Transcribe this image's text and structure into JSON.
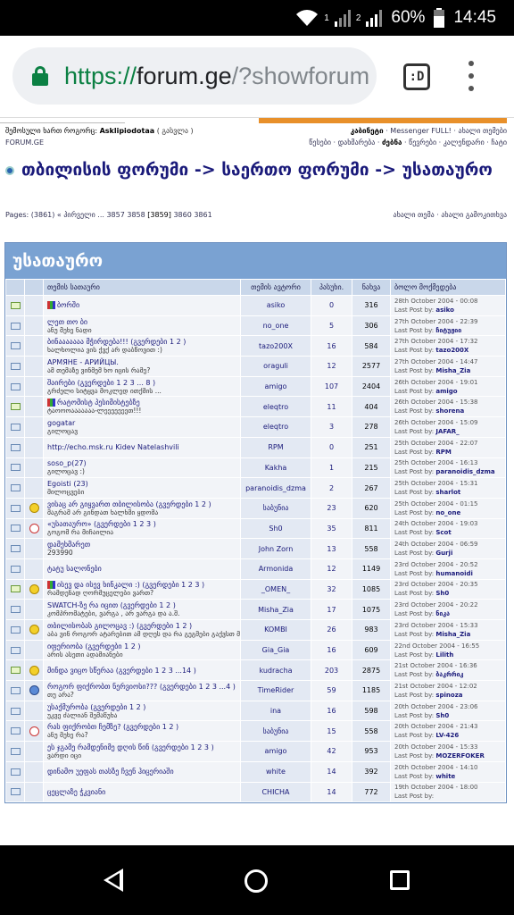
{
  "status": {
    "battery": "60%",
    "time": "14:45",
    "sim1": "1",
    "sim2": "2"
  },
  "browser": {
    "scheme": "https://",
    "host": "forum.ge",
    "path": "/?showforum",
    "tab_count": ":D"
  },
  "header": {
    "user_prefix": "შემოსული ხართ როგორც:",
    "user_name": "Asklipiodotaa",
    "user_logout": "( გასვლა )",
    "site": "FORUM.GE",
    "links_line1": [
      "კაბინეტი",
      "Messenger FULL!",
      "ახალი თემები"
    ],
    "links_line2": [
      "წესები",
      "დახმარება",
      "ძებნა",
      "წევრები",
      "კალენდარი",
      "ჩატი"
    ]
  },
  "breadcrumb": "თბილისის ფორუმი -> საერთო ფორუმი -> უსათაურო",
  "pagination": {
    "label": "Pages: (3861)",
    "first": "« პირველი ...",
    "before": "3857 3858",
    "current": "[3859]",
    "after": "3860 3861",
    "actions": "ახალი თემა · ახალი გამოკითხვა"
  },
  "forum": {
    "title": "უსათაურო",
    "columns": [
      "",
      "",
      "თემის სათაური",
      "თემის ავტორი",
      "პასუხი.",
      "ნახვა",
      "ბოლო მოქმედება"
    ],
    "rows": [
      {
        "icon": "env-hot",
        "mood": "",
        "bars": true,
        "title": "ბორში",
        "desc": "",
        "author": "asiko",
        "replies": "0",
        "views": "316",
        "date": "28th October 2004 - 00:08",
        "last_label": "Last Post by:",
        "last_by": "asiko"
      },
      {
        "icon": "env",
        "mood": "",
        "bars": false,
        "title": "ლეთ თო ბი",
        "desc": "ანუ მეხე ნადი",
        "author": "no_one",
        "replies": "5",
        "views": "306",
        "date": "27th October 2004 - 22:39",
        "last_label": "Last Post by:",
        "last_by": "ჩიტუჟიი"
      },
      {
        "icon": "env",
        "mood": "",
        "bars": false,
        "title": "ბინააააააა მჭირდება!!! (გვერდები 1 2 )",
        "desc": "ხალხოლია ვის ქვქ არ დაბწოვით :)",
        "author": "tazo200X",
        "replies": "16",
        "views": "584",
        "date": "27th October 2004 - 17:32",
        "last_label": "Last Post by:",
        "last_by": "tazo200X"
      },
      {
        "icon": "env",
        "mood": "",
        "bars": false,
        "title": "АРМЯНЕ - АРИЙЦЫ.",
        "desc": "ამ თემაზე ვინმემ ხო იცის რამე?",
        "author": "oraguli",
        "replies": "12",
        "views": "2577",
        "date": "27th October 2004 - 14:47",
        "last_label": "Last Post by:",
        "last_by": "Misha_Zia"
      },
      {
        "icon": "env",
        "mood": "",
        "bars": false,
        "title": "შაირები (გვერდები 1 2 3 ... 8 )",
        "desc": "გრძელი სიტყვა მოკლედ ითქმის ...",
        "author": "amigo",
        "replies": "107",
        "views": "2404",
        "date": "26th October 2004 - 19:01",
        "last_label": "Last Post by:",
        "last_by": "amigo"
      },
      {
        "icon": "env-hot",
        "mood": "",
        "bars": true,
        "title": "რატომისტ პესიმისტებზე",
        "desc": "ტაოოოააააააა-ლეეეეეეეთ!!!",
        "author": "eleqtro",
        "replies": "11",
        "views": "404",
        "date": "26th October 2004 - 15:38",
        "last_label": "Last Post by:",
        "last_by": "shorena"
      },
      {
        "icon": "env",
        "mood": "",
        "bars": false,
        "title": "gogatar",
        "desc": "გილოცავ",
        "author": "eleqtro",
        "replies": "3",
        "views": "278",
        "date": "26th October 2004 - 15:09",
        "last_label": "Last Post by:",
        "last_by": "JAFAR_"
      },
      {
        "icon": "env",
        "mood": "",
        "bars": false,
        "title": "http://echo.msk.ru Kidev Natelashvili",
        "desc": "",
        "author": "RPM",
        "replies": "0",
        "views": "251",
        "date": "25th October 2004 - 22:07",
        "last_label": "Last Post by:",
        "last_by": "RPM"
      },
      {
        "icon": "env",
        "mood": "",
        "bars": false,
        "title": "soso_p(27)",
        "desc": "გილოცავ :)",
        "author": "Kakha",
        "replies": "1",
        "views": "215",
        "date": "25th October 2004 - 16:13",
        "last_label": "Last Post by:",
        "last_by": "paranoidis_dzma"
      },
      {
        "icon": "env",
        "mood": "",
        "bars": false,
        "title": "Egoisti (23)",
        "desc": "მილოცვები",
        "author": "paranoidis_dzma",
        "replies": "2",
        "views": "267",
        "date": "25th October 2004 - 15:31",
        "last_label": "Last Post by:",
        "last_by": "sharlot"
      },
      {
        "icon": "env",
        "mood": "smile",
        "bars": false,
        "title": "ვისაც არ გიყვართ თბილისობა (გვერდები 1 2 )",
        "desc": "მაგრამ არ გინდათ ხალხში ყდომა",
        "author": "საბუნია",
        "replies": "23",
        "views": "620",
        "date": "25th October 2004 - 01:15",
        "last_label": "Last Post by:",
        "last_by": "no_one"
      },
      {
        "icon": "env",
        "mood": "jp",
        "bars": false,
        "title": "«უსათაურო» (გვერდები 1 2 3 )",
        "desc": "გოგომ რა მიჩაილია",
        "author": "Sh0",
        "replies": "35",
        "views": "811",
        "date": "24th October 2004 - 19:03",
        "last_label": "Last Post by:",
        "last_by": "Scot"
      },
      {
        "icon": "env",
        "mood": "",
        "bars": false,
        "title": "დამეხმარეთ",
        "desc": "293990",
        "author": "John Zorn",
        "replies": "13",
        "views": "558",
        "date": "24th October 2004 - 06:59",
        "last_label": "Last Post by:",
        "last_by": "Gurji"
      },
      {
        "icon": "env",
        "mood": "",
        "bars": false,
        "title": "ტატუ სალონები",
        "desc": "",
        "author": "Armonida",
        "replies": "12",
        "views": "1149",
        "date": "23rd October 2004 - 20:52",
        "last_label": "Last Post by:",
        "last_by": "humanoidi"
      },
      {
        "icon": "env-hot",
        "mood": "smile",
        "bars": true,
        "title": "ისევ და ისევ ხინკალი :) (გვერდები 1 2 3 )",
        "desc": "რამდენად ღორმუცელები ვართ?",
        "author": "_OMEN_",
        "replies": "32",
        "views": "1085",
        "date": "23rd October 2004 - 20:35",
        "last_label": "Last Post by:",
        "last_by": "Sh0"
      },
      {
        "icon": "env",
        "mood": "",
        "bars": false,
        "title": "SWATCH-ზე რა იცით (გვერდები 1 2 )",
        "desc": "კომპრომატები, ვარგა , არ ვარგა და ა.შ.",
        "author": "Misha_Zia",
        "replies": "17",
        "views": "1075",
        "date": "23rd October 2004 - 20:22",
        "last_label": "Last Post by:",
        "last_by": "ნიკა"
      },
      {
        "icon": "env",
        "mood": "smile",
        "bars": false,
        "title": "თბილისობას გილოცავ :) (გვერდები 1 2 )",
        "desc": "აბა ვინ როგორ ატარებით ამ დღეს და რა გეგმები გაქვსთ მომავალში",
        "author": "KOMBI",
        "replies": "26",
        "views": "983",
        "date": "23rd October 2004 - 15:33",
        "last_label": "Last Post by:",
        "last_by": "Misha_Zia"
      },
      {
        "icon": "env",
        "mood": "",
        "bars": false,
        "title": "იფერიობა (გვერდები 1 2 )",
        "desc": "არის ასეთი ადამიანები",
        "author": "Gia_Gia",
        "replies": "16",
        "views": "609",
        "date": "22nd October 2004 - 16:55",
        "last_label": "Last Post by:",
        "last_by": "Lilith"
      },
      {
        "icon": "env-hot",
        "mood": "cool",
        "bars": false,
        "title": "მინდა ვიცო სწერაა (გვერდები 1 2 3 ...14 )",
        "desc": "",
        "author": "kudracha",
        "replies": "203",
        "views": "2875",
        "date": "21st October 2004 - 16:36",
        "last_label": "Last Post by:",
        "last_by": "ბაკრრიკ"
      },
      {
        "icon": "env",
        "mood": "q",
        "bars": false,
        "title": "როგორ ფიქრობთ ნერვიოსი??? (გვერდები 1 2 3 ...4 )",
        "desc": "თუ არა?",
        "author": "TimeRider",
        "replies": "59",
        "views": "1185",
        "date": "21st October 2004 - 12:02",
        "last_label": "Last Post by:",
        "last_by": "spinoza"
      },
      {
        "icon": "env",
        "mood": "",
        "bars": false,
        "title": "უსაქმურობა (გვერდები 1 2 )",
        "desc": "უკვე ძალიან შემაწუხა",
        "author": "ina",
        "replies": "16",
        "views": "598",
        "date": "20th October 2004 - 23:06",
        "last_label": "Last Post by:",
        "last_by": "Sh0"
      },
      {
        "icon": "env",
        "mood": "jp",
        "bars": false,
        "title": "რას ფიქრობთ ჩემზე? (გვერდები 1 2 )",
        "desc": "ანუ მეხე რა?",
        "author": "საბუნია",
        "replies": "15",
        "views": "558",
        "date": "20th October 2004 - 21:43",
        "last_label": "Last Post by:",
        "last_by": "LV-426"
      },
      {
        "icon": "env",
        "mood": "",
        "bars": false,
        "title": "ეს ჯგამე რამდენიმე დღის წინ (გვერდები 1 2 3 )",
        "desc": "ვარდი იცი",
        "author": "amigo",
        "replies": "42",
        "views": "953",
        "date": "20th October 2004 - 15:33",
        "last_label": "Last Post by:",
        "last_by": "MOZERFOKER"
      },
      {
        "icon": "env",
        "mood": "",
        "bars": false,
        "title": "დინამო უეფას თასზე ჩვენ ჰიცერიაში",
        "desc": "",
        "author": "white",
        "replies": "14",
        "views": "392",
        "date": "20th October 2004 - 14:10",
        "last_label": "Last Post by:",
        "last_by": "white"
      },
      {
        "icon": "env",
        "mood": "",
        "bars": false,
        "title": "ცეცლაზე ჭკვიანი",
        "desc": "",
        "author": "CHICHA",
        "replies": "14",
        "views": "772",
        "date": "19th October 2004 - 18:00",
        "last_label": "Last Post by:",
        "last_by": ""
      }
    ]
  }
}
